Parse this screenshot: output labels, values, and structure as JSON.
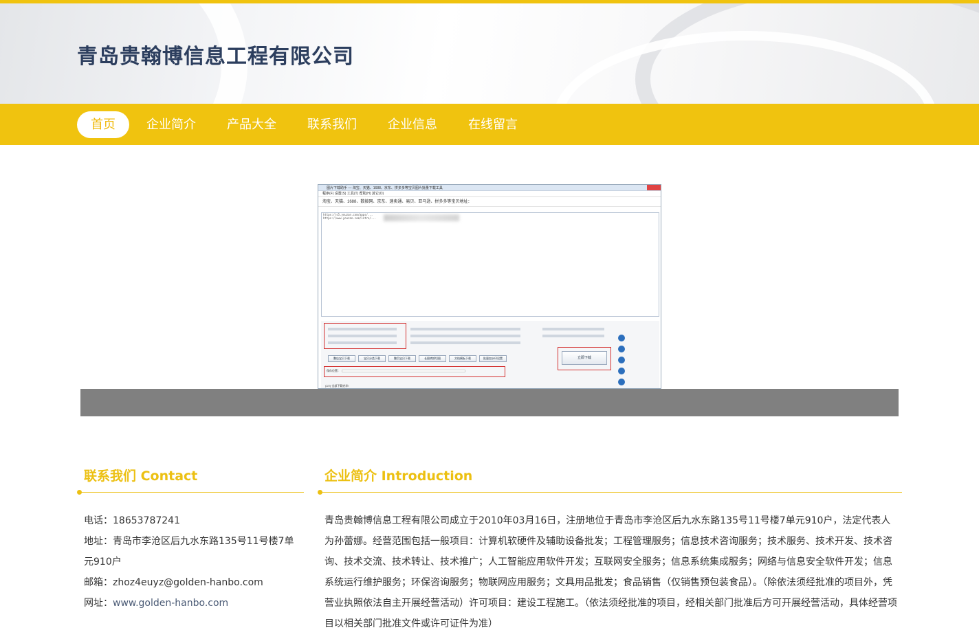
{
  "header": {
    "company_name": "青岛贵翰博信息工程有限公司"
  },
  "nav": {
    "items": [
      {
        "label": "首页",
        "active": true
      },
      {
        "label": "企业简介",
        "active": false
      },
      {
        "label": "产品大全",
        "active": false
      },
      {
        "label": "联系我们",
        "active": false
      },
      {
        "label": "企业信息",
        "active": false
      },
      {
        "label": "在线留言",
        "active": false
      }
    ]
  },
  "banner": {
    "window_title": "图片下载助手 — 淘宝、天猫、1688、京东、拼多多等宝贝图片批量下载工具",
    "menu": "程序(F)   设置(S)   工具(T)   帮助(H)   其它(O)",
    "url_row": "淘宝、天猫、1688、数接网、京东、速卖通、易贝、亚马逊、拼多多等宝贝地址：",
    "text_lines": [
      "https://s5.youzan.com/apps/...",
      "https://www.youzan.com/intro/..."
    ],
    "buttons": [
      "整店宝贝下载",
      "宝贝分类下载",
      "整页宝贝下载",
      "长图转换切图",
      "文档模板下载",
      "批量加水印设置"
    ],
    "download_button": "立即下载",
    "save_label": "保存位置：",
    "status": "(2/2) 全部下载完毕!",
    "colors": {
      "accent_red": "#d32f2f",
      "panel": "#f5f6f8"
    }
  },
  "contact": {
    "title": "联系我们 Contact",
    "phone_label": "电话：",
    "phone": "18653787241",
    "address_label": "地址：",
    "address": "青岛市李沧区后九水东路135号11号楼7单元910户",
    "email_label": "邮箱：",
    "email": "zhoz4euyz@golden-hanbo.com",
    "website_label": "网址：",
    "website": "www.golden-hanbo.com"
  },
  "intro": {
    "title": "企业简介 Introduction",
    "text": "青岛贵翰博信息工程有限公司成立于2010年03月16日，注册地位于青岛市李沧区后九水东路135号11号楼7单元910户，法定代表人为孙蕾娜。经营范围包括一般项目：计算机软硬件及辅助设备批发；工程管理服务；信息技术咨询服务；技术服务、技术开发、技术咨询、技术交流、技术转让、技术推广；人工智能应用软件开发；互联网安全服务；信息系统集成服务；网络与信息安全软件开发；信息系统运行维护服务；环保咨询服务；物联网应用服务；文具用品批发；食品销售（仅销售预包装食品）。（除依法须经批准的项目外，凭营业执照依法自主开展经营活动）许可项目：建设工程施工。（依法须经批准的项目，经相关部门批准后方可开展经营活动，具体经营项目以相关部门批准文件或许可证件为准）"
  },
  "colors": {
    "brand_yellow": "#f0c30f",
    "title_blue": "#2c3e5e"
  }
}
